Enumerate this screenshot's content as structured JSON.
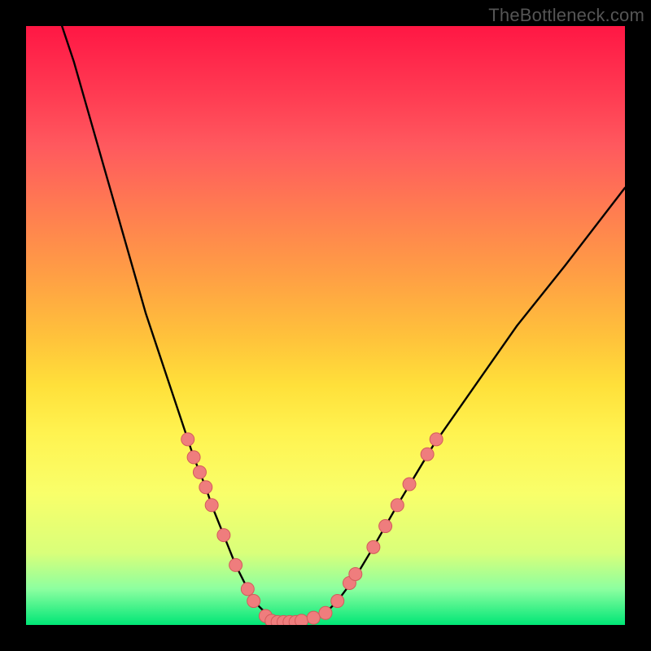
{
  "attribution": "TheBottleneck.com",
  "colors": {
    "curve_stroke": "#000000",
    "marker_fill": "#ef7d7d",
    "marker_stroke": "#d35b5b"
  },
  "chart_data": {
    "type": "line",
    "title": "",
    "xlabel": "",
    "ylabel": "",
    "xlim": [
      0,
      100
    ],
    "ylim": [
      0,
      100
    ],
    "series": [
      {
        "name": "bottleneck-curve",
        "x": [
          6,
          8,
          10,
          12,
          14,
          16,
          18,
          20,
          22,
          24,
          26,
          27,
          28,
          30,
          31,
          33,
          35,
          37,
          38,
          40,
          41,
          42,
          43,
          44,
          46,
          48,
          50,
          52,
          55,
          58,
          62,
          68,
          75,
          82,
          90,
          100
        ],
        "y": [
          100,
          94,
          87,
          80,
          73,
          66,
          59,
          52,
          46,
          40,
          34,
          31,
          28,
          23,
          20,
          15,
          10,
          6,
          4,
          2,
          1,
          0.5,
          0.5,
          0.5,
          0.5,
          1,
          2,
          4,
          8,
          13,
          20,
          30,
          40,
          50,
          60,
          73
        ]
      }
    ],
    "markers": {
      "name": "bottleneck-points",
      "items": [
        {
          "x": 27.0,
          "y": 31.0
        },
        {
          "x": 28.0,
          "y": 28.0
        },
        {
          "x": 29.0,
          "y": 25.5
        },
        {
          "x": 30.0,
          "y": 23.0
        },
        {
          "x": 31.0,
          "y": 20.0
        },
        {
          "x": 33.0,
          "y": 15.0
        },
        {
          "x": 35.0,
          "y": 10.0
        },
        {
          "x": 37.0,
          "y": 6.0
        },
        {
          "x": 38.0,
          "y": 4.0
        },
        {
          "x": 40.0,
          "y": 1.5
        },
        {
          "x": 41.0,
          "y": 0.7
        },
        {
          "x": 42.0,
          "y": 0.5
        },
        {
          "x": 43.0,
          "y": 0.5
        },
        {
          "x": 44.0,
          "y": 0.5
        },
        {
          "x": 45.0,
          "y": 0.5
        },
        {
          "x": 46.0,
          "y": 0.7
        },
        {
          "x": 48.0,
          "y": 1.2
        },
        {
          "x": 50.0,
          "y": 2.0
        },
        {
          "x": 52.0,
          "y": 4.0
        },
        {
          "x": 54.0,
          "y": 7.0
        },
        {
          "x": 55.0,
          "y": 8.5
        },
        {
          "x": 58.0,
          "y": 13.0
        },
        {
          "x": 60.0,
          "y": 16.5
        },
        {
          "x": 62.0,
          "y": 20.0
        },
        {
          "x": 64.0,
          "y": 23.5
        },
        {
          "x": 67.0,
          "y": 28.5
        },
        {
          "x": 68.5,
          "y": 31.0
        }
      ]
    }
  }
}
